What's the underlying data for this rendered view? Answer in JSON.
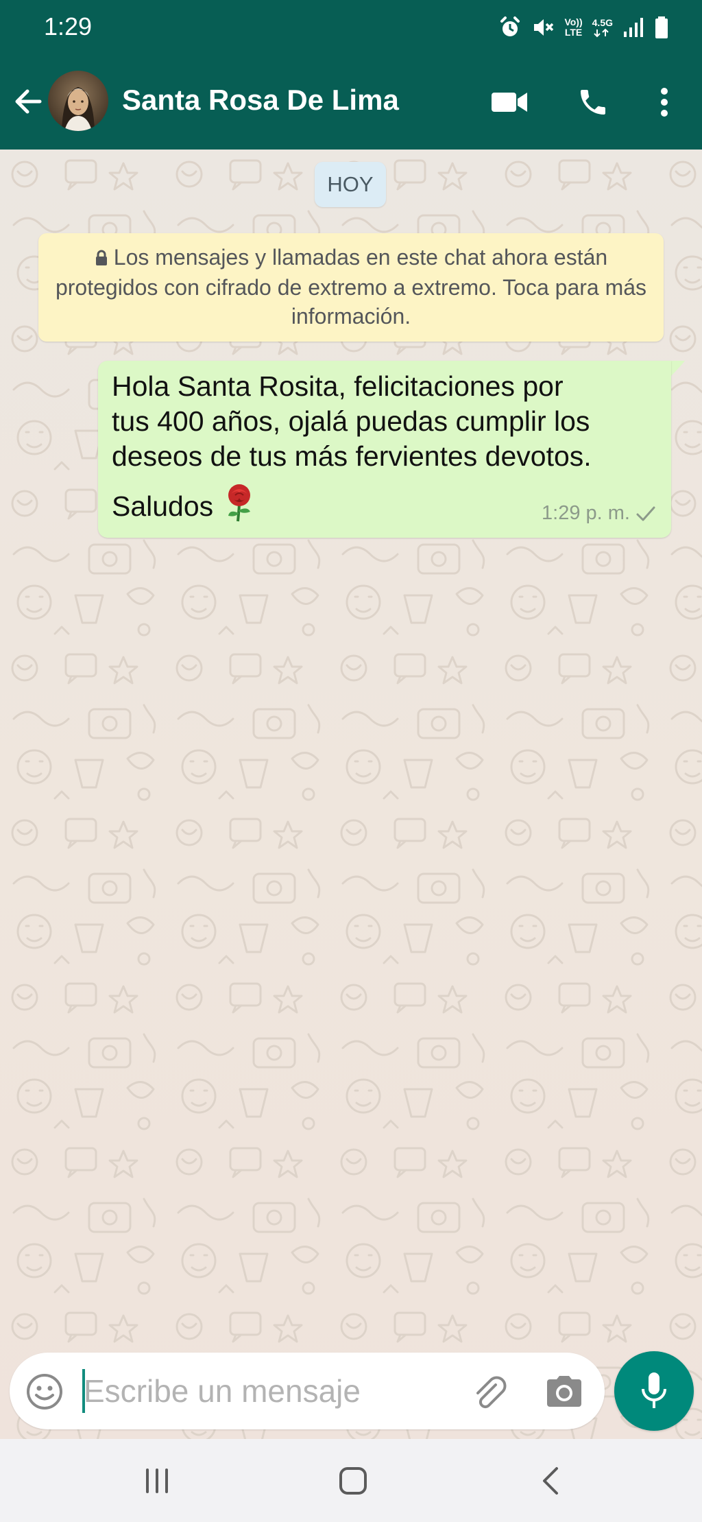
{
  "status_bar": {
    "time": "1:29",
    "volte_label": "Vo))",
    "lte_label": "LTE",
    "network_label": "4.5G"
  },
  "header": {
    "contact_name": "Santa Rosa De Lima",
    "icons": [
      "back-arrow-icon",
      "video-call-icon",
      "phone-icon",
      "more-vert-icon"
    ],
    "color": "#075e54"
  },
  "chat": {
    "date_chip": "HOY",
    "encryption_notice": "Los mensajes y llamadas en este chat ahora están protegidos con cifrado de extremo a extremo. Toca para más información.",
    "messages": [
      {
        "text": "Hola Santa Rosita, felicitaciones por\ntus 400 años, ojalá puedas cumplir los\ndeseos de tus más fervientes devotos.",
        "text_line2": "Saludos",
        "emoji": "rose",
        "time": "1:29 p. m.",
        "status": "sent"
      }
    ],
    "bubble_color": "#dcf8c6"
  },
  "input": {
    "placeholder": "Escribe un mensaje",
    "accent": "#00897b"
  },
  "nav": {
    "buttons": [
      "recent-apps",
      "home",
      "back"
    ]
  }
}
